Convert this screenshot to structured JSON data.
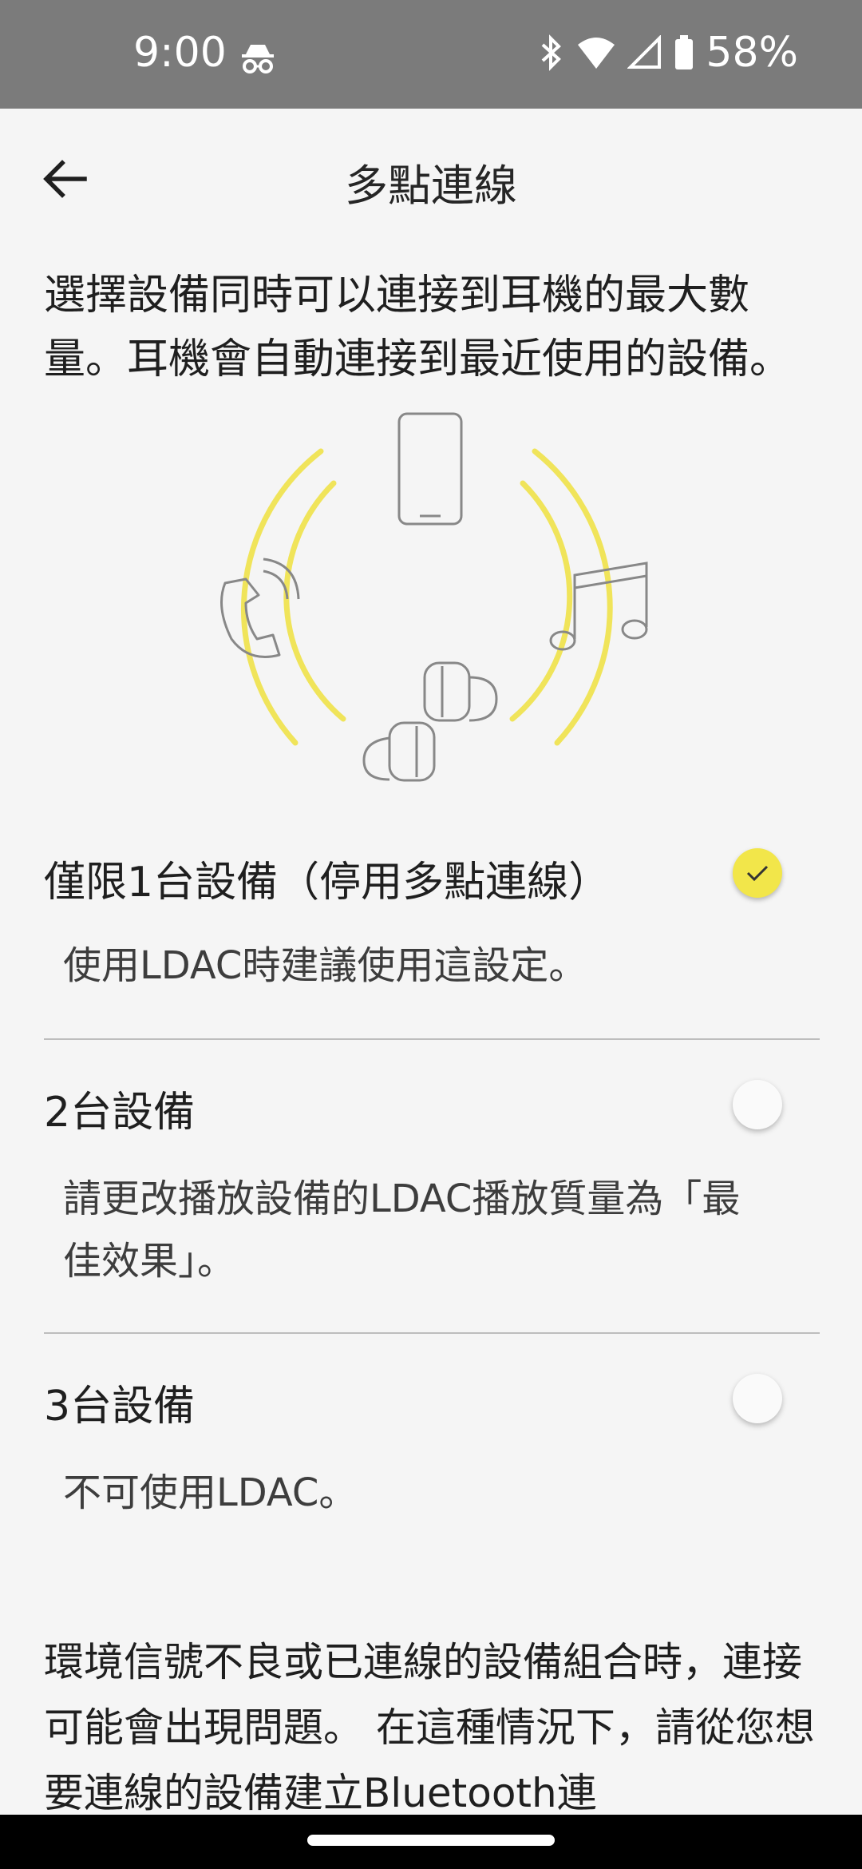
{
  "status_bar": {
    "time": "9:00",
    "battery_percent": "58%"
  },
  "header": {
    "title": "多點連線"
  },
  "description": "選擇設備同時可以連接到耳機的最大數量。耳機會自動連接到最近使用的設備。",
  "options": [
    {
      "label": "僅限1台設備（停用多點連線）",
      "sub": "使用LDAC時建議使用這設定。",
      "selected": true
    },
    {
      "label": "2台設備",
      "sub": "請更改播放設備的LDAC播放質量為「最佳效果」。",
      "selected": false
    },
    {
      "label": "3台設備",
      "sub": "不可使用LDAC。",
      "selected": false
    }
  ],
  "note": "環境信號不良或已連線的設備組合時，連接可能會出現問題。 在這種情況下，請從您想要連線的設備建立Bluetooth連",
  "colors": {
    "accent": "#f2e64a",
    "statusbar": "#7b7b7b"
  },
  "icons": [
    "back-arrow-icon",
    "incognito-icon",
    "bluetooth-icon",
    "wifi-icon",
    "signal-icon",
    "battery-icon",
    "check-icon"
  ]
}
